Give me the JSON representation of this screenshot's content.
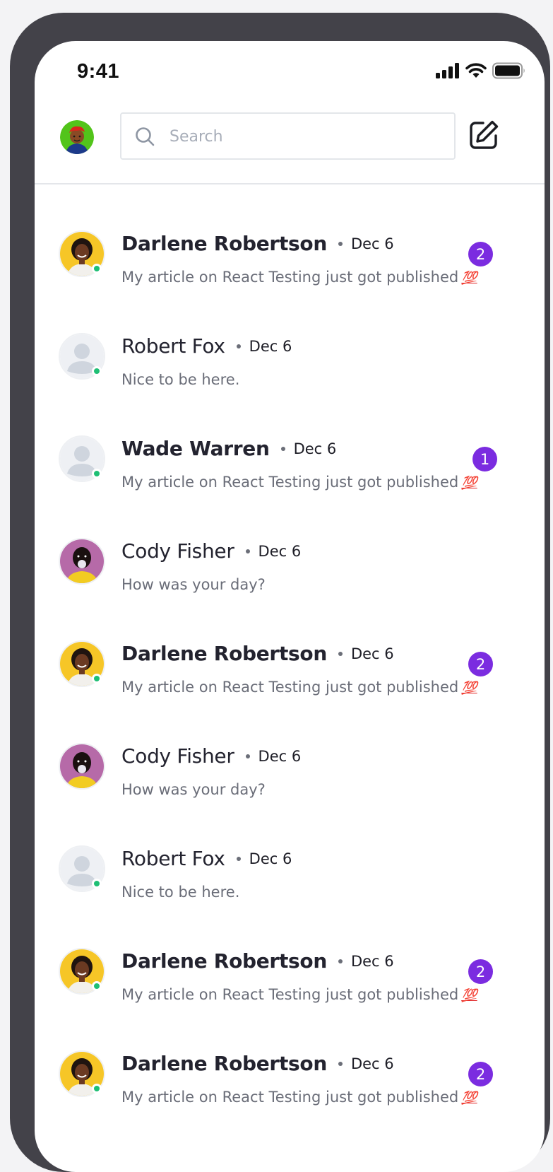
{
  "status_bar": {
    "time": "9:41"
  },
  "search": {
    "placeholder": "Search",
    "value": ""
  },
  "colors": {
    "accent": "#7b2ce0",
    "online": "#1fbf75"
  },
  "conversations": [
    {
      "name": "Darlene Robertson",
      "date": "Dec 6",
      "preview": "My article on React Testing just got published",
      "emoji": "💯",
      "unread": "2",
      "avatar": "darlene",
      "online": true
    },
    {
      "name": "Robert Fox",
      "date": "Dec 6",
      "preview": "Nice to be here.",
      "emoji": "",
      "unread": "",
      "avatar": "placeholder",
      "online": true
    },
    {
      "name": "Wade Warren",
      "date": "Dec 6",
      "preview": "My article on React Testing just got published",
      "emoji": "💯",
      "unread": "1",
      "avatar": "placeholder",
      "online": true
    },
    {
      "name": "Cody Fisher",
      "date": "Dec 6",
      "preview": "How was your day?",
      "emoji": "",
      "unread": "",
      "avatar": "cody",
      "online": false
    },
    {
      "name": "Darlene Robertson",
      "date": "Dec 6",
      "preview": "My article on React Testing just got published",
      "emoji": "💯",
      "unread": "2",
      "avatar": "darlene",
      "online": true
    },
    {
      "name": "Cody Fisher",
      "date": "Dec 6",
      "preview": "How was your day?",
      "emoji": "",
      "unread": "",
      "avatar": "cody",
      "online": false
    },
    {
      "name": "Robert Fox",
      "date": "Dec 6",
      "preview": "Nice to be here.",
      "emoji": "",
      "unread": "",
      "avatar": "placeholder",
      "online": true
    },
    {
      "name": "Darlene Robertson",
      "date": "Dec 6",
      "preview": "My article on React Testing just got published",
      "emoji": "💯",
      "unread": "2",
      "avatar": "darlene",
      "online": true
    },
    {
      "name": "Darlene Robertson",
      "date": "Dec 6",
      "preview": "My article on React Testing just got published",
      "emoji": "💯",
      "unread": "2",
      "avatar": "darlene",
      "online": true
    }
  ]
}
